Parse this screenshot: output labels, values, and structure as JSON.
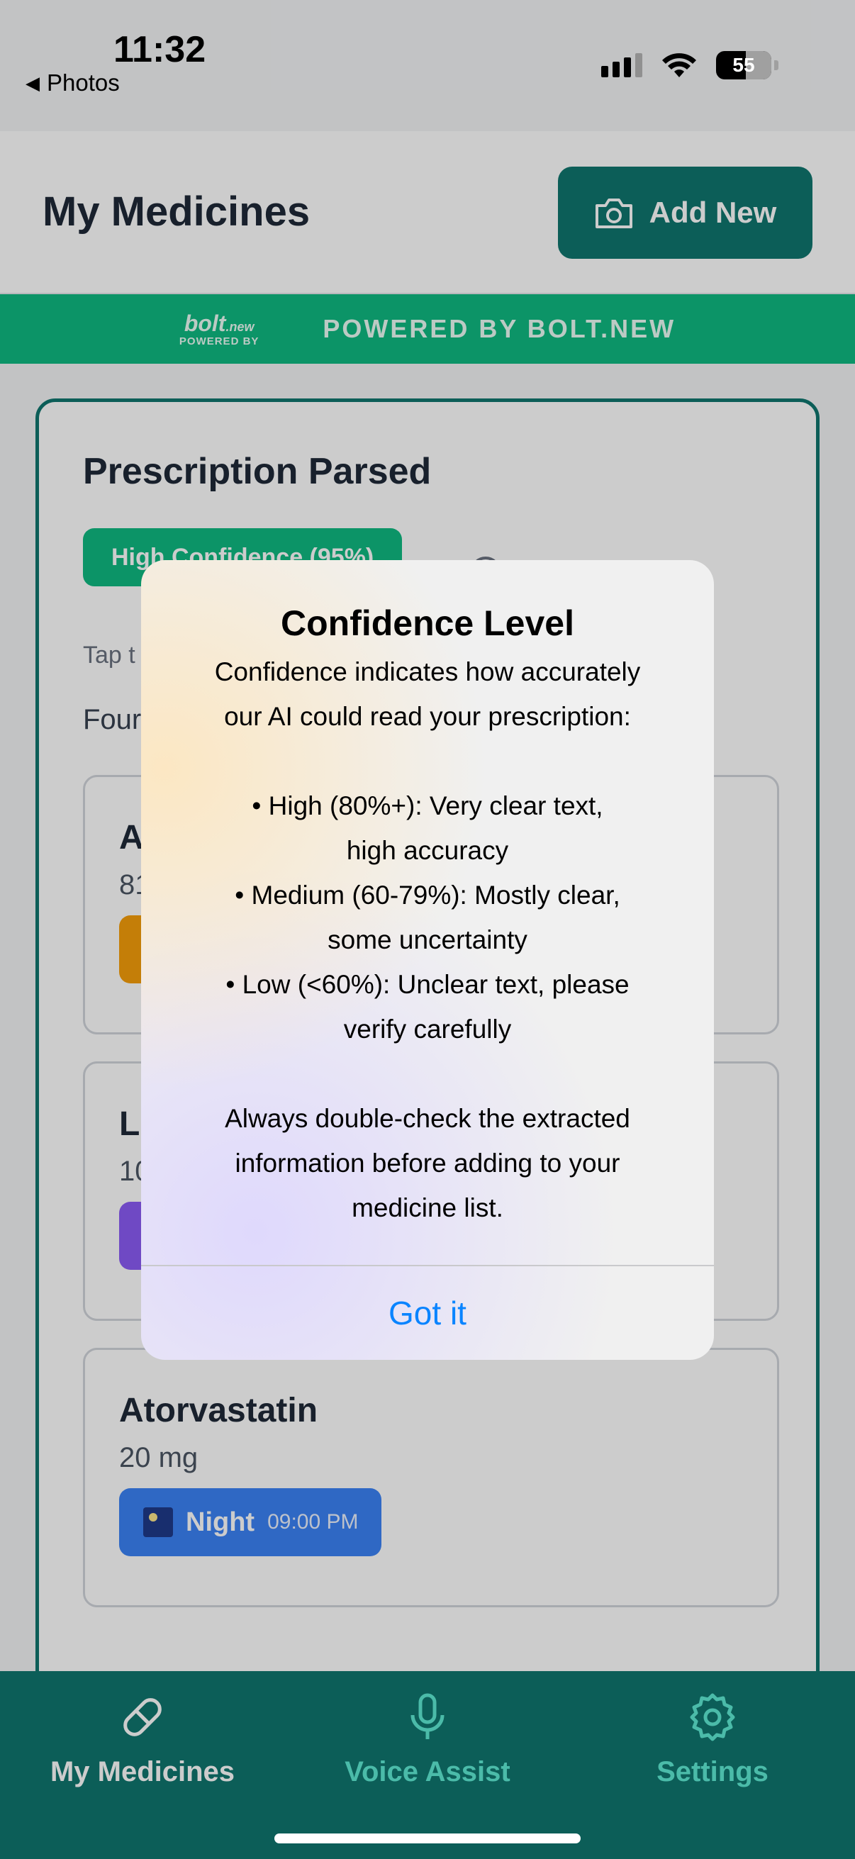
{
  "status_bar": {
    "time": "11:32",
    "back_label": "Photos",
    "battery": "55"
  },
  "header": {
    "title": "My Medicines",
    "add_button": "Add New"
  },
  "banner": {
    "logo_main": "bolt",
    "logo_suffix": ".new",
    "logo_sub": "POWERED BY",
    "text": "POWERED BY BOLT.NEW"
  },
  "card": {
    "title": "Prescription Parsed",
    "confidence": "High Confidence (95%)",
    "hint": "Tap t",
    "found": "Four",
    "medicines": [
      {
        "name": "A",
        "dose": "81",
        "time_label": "",
        "time": "",
        "color": "#f59e0b"
      },
      {
        "name": "Li",
        "dose": "10",
        "time_label": "",
        "time": "",
        "color": "#8b5cf6"
      },
      {
        "name": "Atorvastatin",
        "dose": "20 mg",
        "time_label": "Night",
        "time": "09:00 PM",
        "color": "#3b82f6"
      }
    ]
  },
  "alert": {
    "title": "Confidence Level",
    "lines": [
      "Confidence indicates how accurately",
      "our AI could read your prescription:",
      "",
      "• High (80%+): Very clear text,",
      "high accuracy",
      "• Medium (60-79%): Mostly clear,",
      "some uncertainty",
      "• Low (<60%): Unclear text, please",
      "verify carefully",
      "",
      "Always double-check the extracted",
      "information before adding to your",
      "medicine list."
    ],
    "button": "Got it"
  },
  "tabs": [
    {
      "label": "My Medicines",
      "icon": "pill-icon",
      "active": true
    },
    {
      "label": "Voice Assist",
      "icon": "microphone-icon",
      "active": false
    },
    {
      "label": "Settings",
      "icon": "gear-icon",
      "active": false
    }
  ],
  "colors": {
    "brand": "#0f766e",
    "banner": "#10b981",
    "link": "#0a84ff"
  }
}
